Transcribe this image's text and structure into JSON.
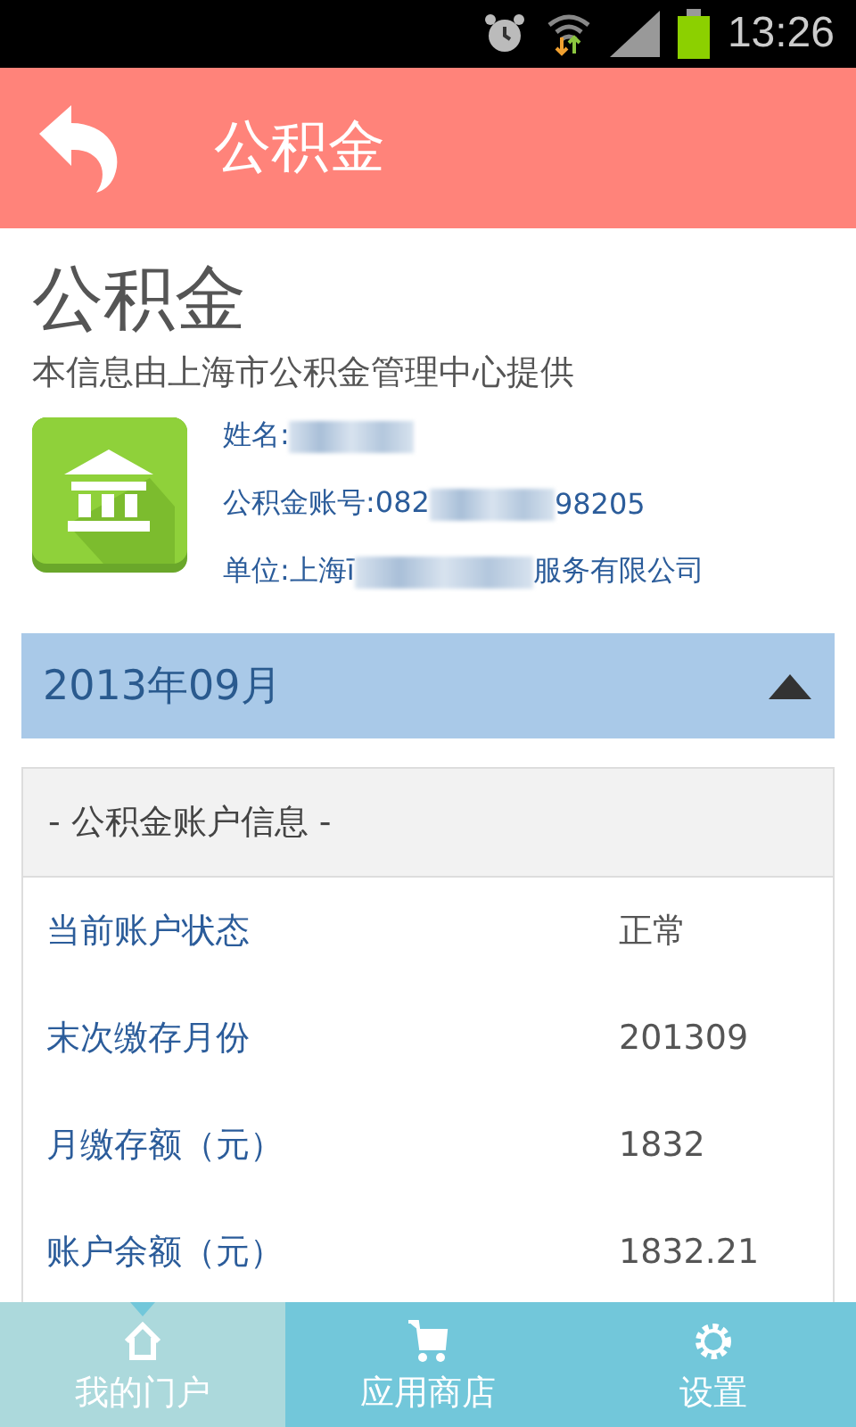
{
  "status_bar": {
    "time": "13:26"
  },
  "header": {
    "title": "公积金"
  },
  "info": {
    "title": "公积金",
    "subtitle": "本信息由上海市公积金管理中心提供",
    "fields": [
      {
        "before": "姓名:"
      },
      {
        "before": "公积金账号:082",
        "after": "98205"
      },
      {
        "before": "单位:上海ī",
        "after": "服务有限公司"
      }
    ]
  },
  "month_bar": {
    "label": "2013年09月",
    "expanded": true
  },
  "account": {
    "heading": "- 公积金账户信息 -",
    "rows": [
      {
        "label": "当前账户状态",
        "value": "正常"
      },
      {
        "label": "末次缴存月份",
        "value": "201309"
      },
      {
        "label": "月缴存额（元）",
        "value": "1832"
      },
      {
        "label": "账户余额（元）",
        "value": "1832.21"
      }
    ]
  },
  "tabs": [
    {
      "label": "我的门户",
      "kind": "home",
      "selected": true
    },
    {
      "label": "应用商店",
      "kind": "cart",
      "selected": false
    },
    {
      "label": "设置",
      "kind": "gear",
      "selected": false
    }
  ]
}
